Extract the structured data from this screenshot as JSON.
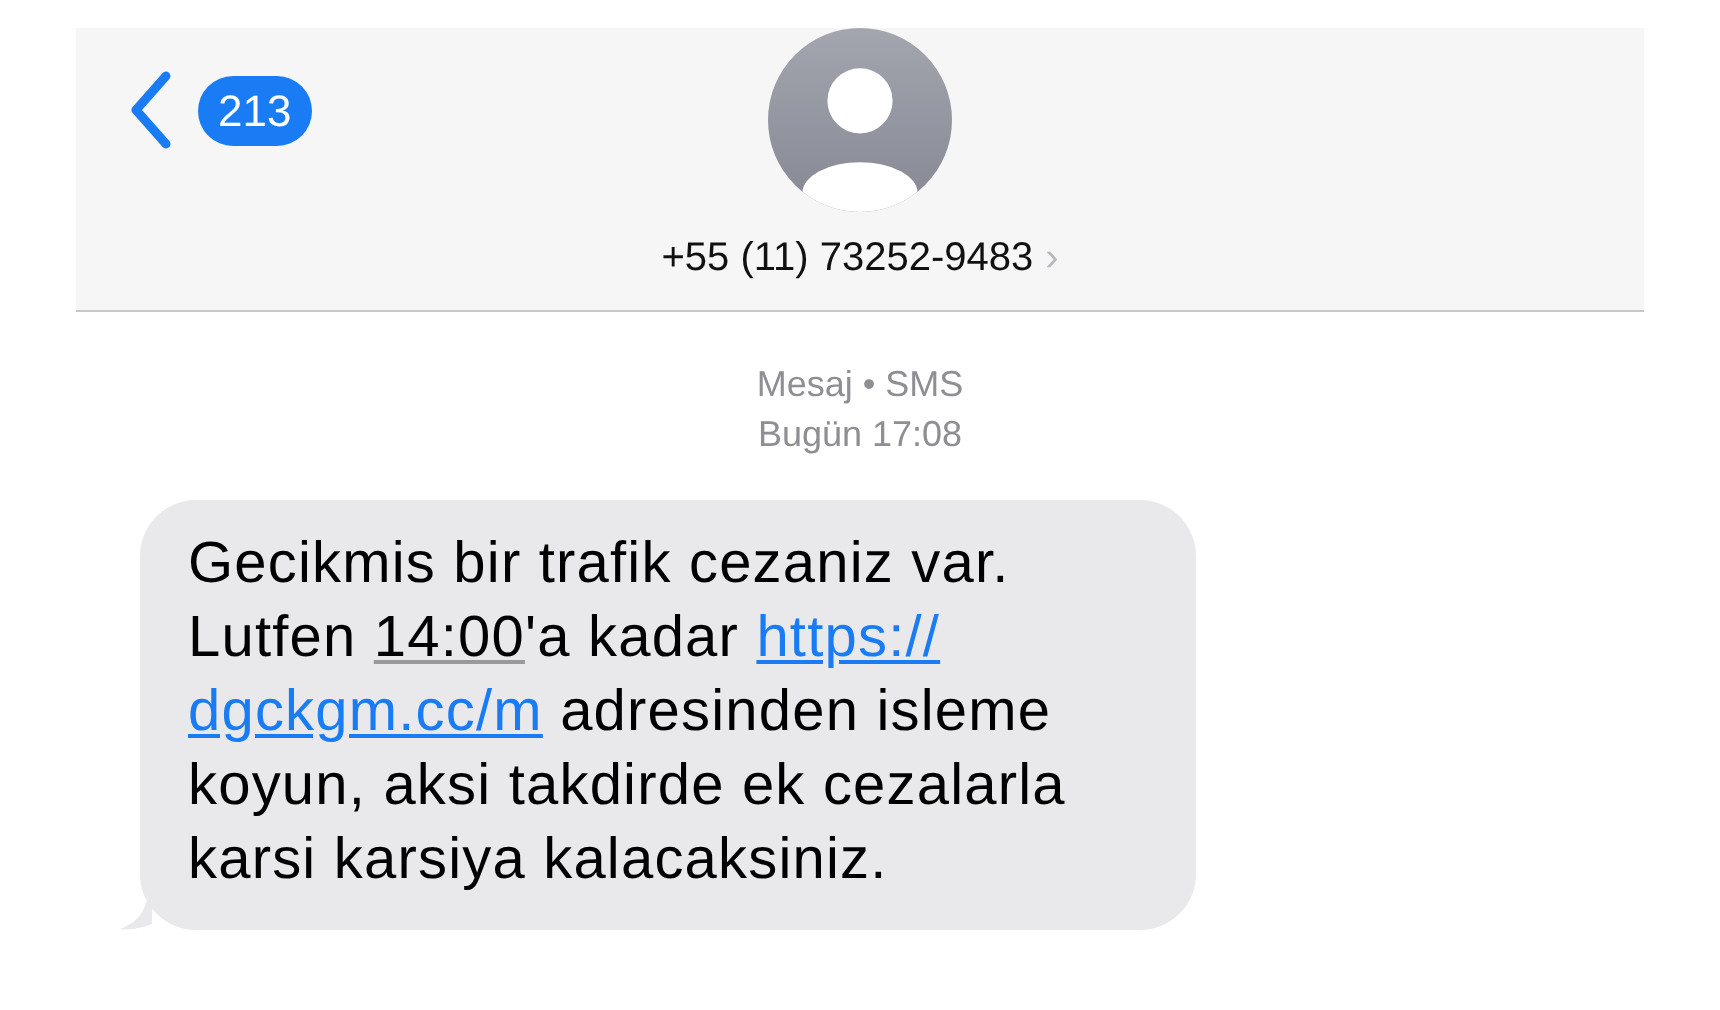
{
  "header": {
    "back_count": "213",
    "contact": "+55 (11) 73252-9483",
    "chevron": "›"
  },
  "meta": {
    "service": "Mesaj • SMS",
    "time": "Bugün 17:08"
  },
  "message": {
    "lines": [
      [
        {
          "kind": "text",
          "text": "Gecikmis bir trafik cezaniz var."
        }
      ],
      [
        {
          "kind": "text",
          "text": "Lutfen "
        },
        {
          "kind": "time",
          "text": "14:00"
        },
        {
          "kind": "text",
          "text": "'a kadar "
        },
        {
          "kind": "link",
          "text": "https://"
        }
      ],
      [
        {
          "kind": "link",
          "text": "dgckgm.cc/m"
        },
        {
          "kind": "text",
          "text": " adresinden isleme"
        }
      ],
      [
        {
          "kind": "text",
          "text": "koyun, aksi takdirde ek cezalarla"
        }
      ],
      [
        {
          "kind": "text",
          "text": "karsi karsiya kalacaksiniz."
        }
      ]
    ]
  }
}
